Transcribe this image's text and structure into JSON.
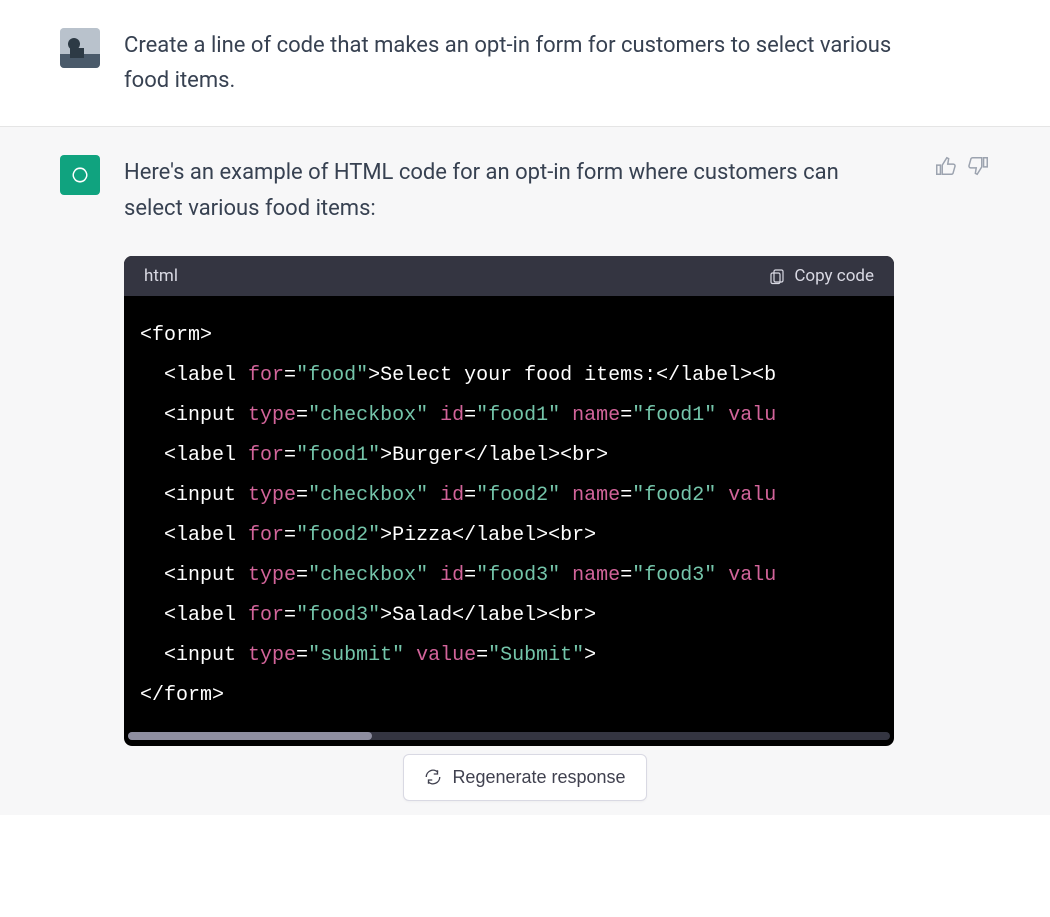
{
  "user": {
    "prompt": "Create a line of code that makes an opt-in form for customers to select various food items."
  },
  "assistant": {
    "intro": "Here's an example of HTML code for an opt-in form where customers can select various food items:",
    "codeblock": {
      "lang_label": "html",
      "copy_label": "Copy code",
      "lines": [
        [
          {
            "t": "tag",
            "v": "<form>"
          }
        ],
        [
          {
            "t": "tag",
            "v": "  <label "
          },
          {
            "t": "attr",
            "v": "for"
          },
          {
            "t": "tag",
            "v": "="
          },
          {
            "t": "str",
            "v": "\"food\""
          },
          {
            "t": "tag",
            "v": ">"
          },
          {
            "t": "txt",
            "v": "Select your food items:"
          },
          {
            "t": "tag",
            "v": "</label><b"
          }
        ],
        [
          {
            "t": "tag",
            "v": "  <input "
          },
          {
            "t": "attr",
            "v": "type"
          },
          {
            "t": "tag",
            "v": "="
          },
          {
            "t": "str",
            "v": "\"checkbox\""
          },
          {
            "t": "tag",
            "v": " "
          },
          {
            "t": "attr",
            "v": "id"
          },
          {
            "t": "tag",
            "v": "="
          },
          {
            "t": "str",
            "v": "\"food1\""
          },
          {
            "t": "tag",
            "v": " "
          },
          {
            "t": "attr",
            "v": "name"
          },
          {
            "t": "tag",
            "v": "="
          },
          {
            "t": "str",
            "v": "\"food1\""
          },
          {
            "t": "tag",
            "v": " "
          },
          {
            "t": "attr",
            "v": "valu"
          }
        ],
        [
          {
            "t": "tag",
            "v": "  <label "
          },
          {
            "t": "attr",
            "v": "for"
          },
          {
            "t": "tag",
            "v": "="
          },
          {
            "t": "str",
            "v": "\"food1\""
          },
          {
            "t": "tag",
            "v": ">"
          },
          {
            "t": "txt",
            "v": "Burger"
          },
          {
            "t": "tag",
            "v": "</label><br>"
          }
        ],
        [
          {
            "t": "tag",
            "v": "  <input "
          },
          {
            "t": "attr",
            "v": "type"
          },
          {
            "t": "tag",
            "v": "="
          },
          {
            "t": "str",
            "v": "\"checkbox\""
          },
          {
            "t": "tag",
            "v": " "
          },
          {
            "t": "attr",
            "v": "id"
          },
          {
            "t": "tag",
            "v": "="
          },
          {
            "t": "str",
            "v": "\"food2\""
          },
          {
            "t": "tag",
            "v": " "
          },
          {
            "t": "attr",
            "v": "name"
          },
          {
            "t": "tag",
            "v": "="
          },
          {
            "t": "str",
            "v": "\"food2\""
          },
          {
            "t": "tag",
            "v": " "
          },
          {
            "t": "attr",
            "v": "valu"
          }
        ],
        [
          {
            "t": "tag",
            "v": "  <label "
          },
          {
            "t": "attr",
            "v": "for"
          },
          {
            "t": "tag",
            "v": "="
          },
          {
            "t": "str",
            "v": "\"food2\""
          },
          {
            "t": "tag",
            "v": ">"
          },
          {
            "t": "txt",
            "v": "Pizza"
          },
          {
            "t": "tag",
            "v": "</label><br>"
          }
        ],
        [
          {
            "t": "tag",
            "v": "  <input "
          },
          {
            "t": "attr",
            "v": "type"
          },
          {
            "t": "tag",
            "v": "="
          },
          {
            "t": "str",
            "v": "\"checkbox\""
          },
          {
            "t": "tag",
            "v": " "
          },
          {
            "t": "attr",
            "v": "id"
          },
          {
            "t": "tag",
            "v": "="
          },
          {
            "t": "str",
            "v": "\"food3\""
          },
          {
            "t": "tag",
            "v": " "
          },
          {
            "t": "attr",
            "v": "name"
          },
          {
            "t": "tag",
            "v": "="
          },
          {
            "t": "str",
            "v": "\"food3\""
          },
          {
            "t": "tag",
            "v": " "
          },
          {
            "t": "attr",
            "v": "valu"
          }
        ],
        [
          {
            "t": "tag",
            "v": "  <label "
          },
          {
            "t": "attr",
            "v": "for"
          },
          {
            "t": "tag",
            "v": "="
          },
          {
            "t": "str",
            "v": "\"food3\""
          },
          {
            "t": "tag",
            "v": ">"
          },
          {
            "t": "txt",
            "v": "Salad"
          },
          {
            "t": "tag",
            "v": "</label><br>"
          }
        ],
        [
          {
            "t": "tag",
            "v": "  <input "
          },
          {
            "t": "attr",
            "v": "type"
          },
          {
            "t": "tag",
            "v": "="
          },
          {
            "t": "str",
            "v": "\"submit\""
          },
          {
            "t": "tag",
            "v": " "
          },
          {
            "t": "attr",
            "v": "value"
          },
          {
            "t": "tag",
            "v": "="
          },
          {
            "t": "str",
            "v": "\"Submit\""
          },
          {
            "t": "tag",
            "v": ">"
          }
        ],
        [
          {
            "t": "tag",
            "v": "</form>"
          }
        ]
      ]
    }
  },
  "actions": {
    "regenerate_label": "Regenerate response"
  }
}
